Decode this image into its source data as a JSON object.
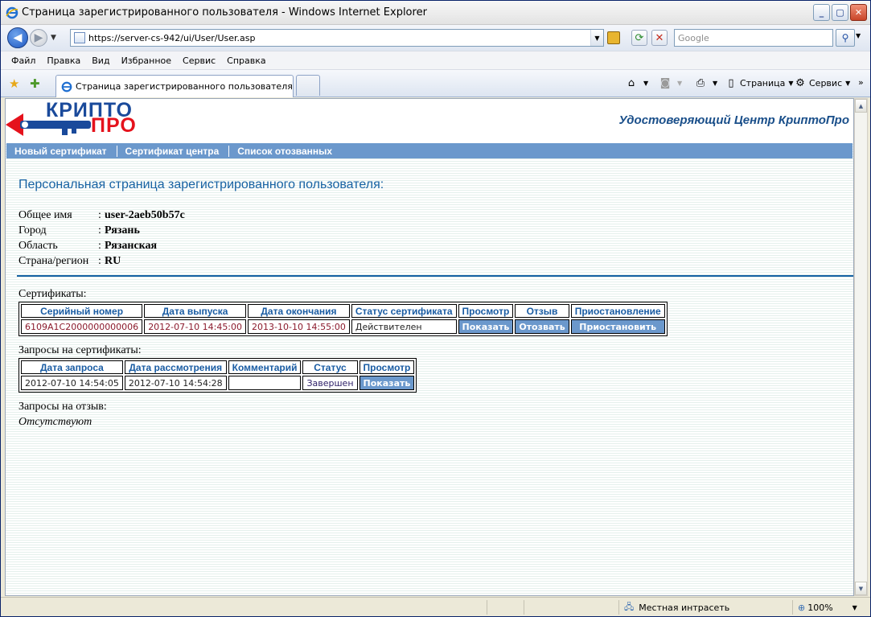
{
  "window": {
    "title": "Страница зарегистрированного пользователя - Windows Internet Explorer"
  },
  "address": {
    "url": "https://server-cs-942/ui/User/User.asp",
    "search_placeholder": "Google"
  },
  "menu": [
    "Файл",
    "Правка",
    "Вид",
    "Избранное",
    "Сервис",
    "Справка"
  ],
  "tab": {
    "label": "Страница зарегистрированного пользователя"
  },
  "commands": {
    "page": "Страница",
    "tools": "Сервис"
  },
  "site": {
    "logo_top": "КРИПТО",
    "logo_bottom": "ПРО",
    "center_title": "Удостоверяющий Центр КриптоПро",
    "nav": [
      "Новый сертификат",
      "Сертификат центра",
      "Список отозванных"
    ],
    "page_title": "Персональная страница зарегистрированного пользователя:"
  },
  "user": {
    "rows": [
      {
        "label": "Общее имя",
        "value": "user-2aeb50b57c"
      },
      {
        "label": "Город",
        "value": "Рязань"
      },
      {
        "label": "Область",
        "value": "Рязанская"
      },
      {
        "label": "Страна/регион",
        "value": "RU"
      }
    ]
  },
  "certificates": {
    "label": "Сертификаты:",
    "headers": [
      "Серийный номер",
      "Дата выпуска",
      "Дата окончания",
      "Статус сертификата",
      "Просмотр",
      "Отзыв",
      "Приостановление"
    ],
    "row": {
      "serial": "6109A1C2000000000006",
      "issued": "2012-07-10 14:45:00",
      "expires": "2013-10-10 14:55:00",
      "status": "Действителен",
      "view": "Показать",
      "revoke": "Отозвать",
      "suspend": "Приостановить"
    }
  },
  "requests": {
    "label": "Запросы на сертификаты:",
    "headers": [
      "Дата запроса",
      "Дата рассмотрения",
      "Комментарий",
      "Статус",
      "Просмотр"
    ],
    "row": {
      "requested": "2012-07-10 14:54:05",
      "reviewed": "2012-07-10 14:54:28",
      "comment": "",
      "status": "Завершен",
      "view": "Показать"
    }
  },
  "revocations": {
    "label": "Запросы на отзыв:",
    "empty": "Отсутствуют"
  },
  "status": {
    "zone": "Местная интрасеть",
    "zoom": "100%"
  }
}
